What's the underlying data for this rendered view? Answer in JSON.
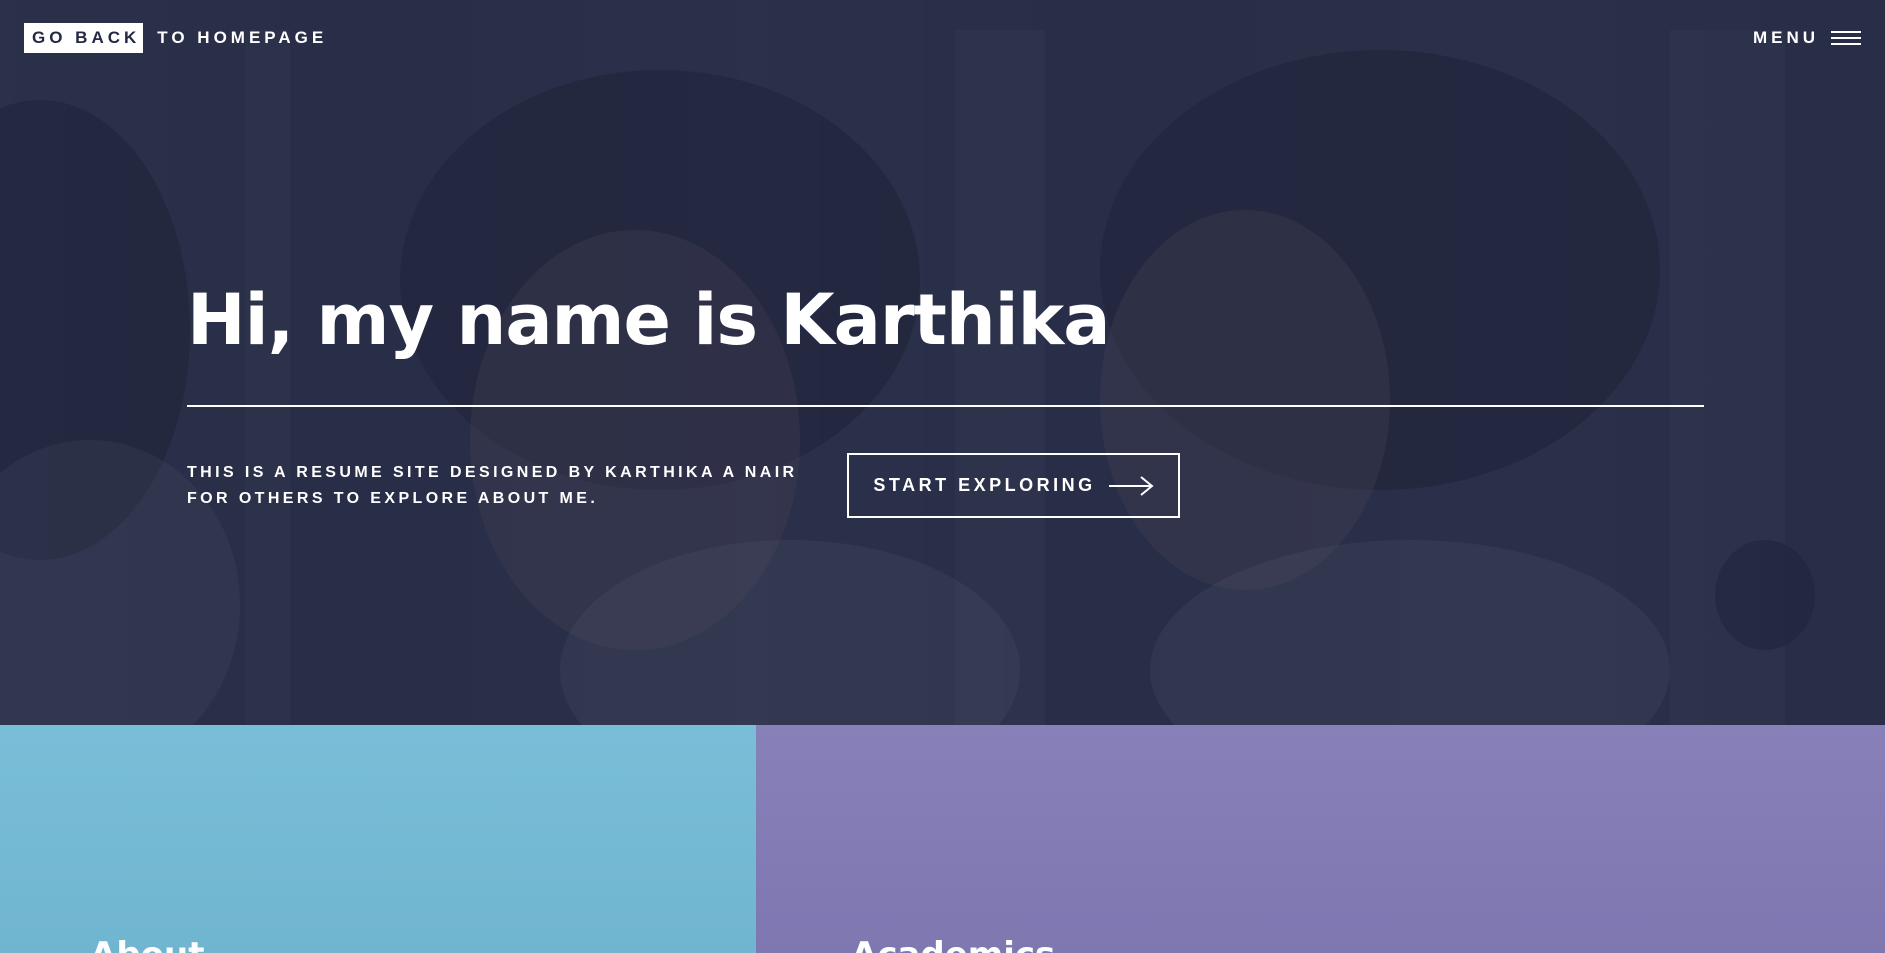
{
  "header": {
    "logo_box": "GO BACK",
    "logo_rest": "TO HOMEPAGE",
    "menu_label": "MENU",
    "menu_icon": "hamburger-icon"
  },
  "banner": {
    "title": "Hi, my name is Karthika",
    "description": "THIS IS A RESUME SITE DESIGNED BY KARTHIKA A NAIR FOR OTHERS TO EXPLORE ABOUT ME.",
    "button_label": "START EXPLORING",
    "button_icon": "arrow-right-icon"
  },
  "tiles": [
    {
      "title": "About",
      "color": "#74bbd6"
    },
    {
      "title": "Academics",
      "color": "#837bb6"
    }
  ],
  "colors": {
    "overlay": "#242943",
    "text": "#ffffff"
  }
}
